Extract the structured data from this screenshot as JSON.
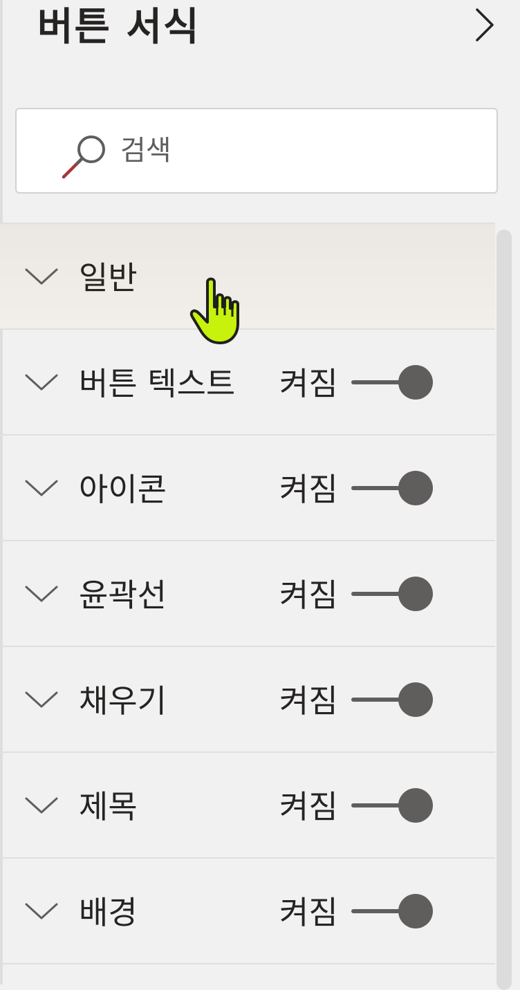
{
  "pane": {
    "title": "버튼 서식",
    "collapse_icon": "chevron-right-icon"
  },
  "search": {
    "placeholder": "검색",
    "value": "",
    "icon": "search-icon"
  },
  "sections": [
    {
      "label": "일반",
      "has_toggle": false,
      "hovered": true
    },
    {
      "label": "버튼 텍스트",
      "has_toggle": true,
      "toggle_label": "켜짐",
      "toggle_on": true
    },
    {
      "label": "아이콘",
      "has_toggle": true,
      "toggle_label": "켜짐",
      "toggle_on": true
    },
    {
      "label": "윤곽선",
      "has_toggle": true,
      "toggle_label": "켜짐",
      "toggle_on": true
    },
    {
      "label": "채우기",
      "has_toggle": true,
      "toggle_label": "켜짐",
      "toggle_on": true
    },
    {
      "label": "제목",
      "has_toggle": true,
      "toggle_label": "켜짐",
      "toggle_on": true
    },
    {
      "label": "배경",
      "has_toggle": true,
      "toggle_label": "켜짐",
      "toggle_on": true
    }
  ],
  "colors": {
    "background": "#f2f1f1",
    "text": "#252423",
    "toggle": "#605e5c",
    "divider": "#e1dfdd",
    "cursor": "#c6f20c"
  }
}
